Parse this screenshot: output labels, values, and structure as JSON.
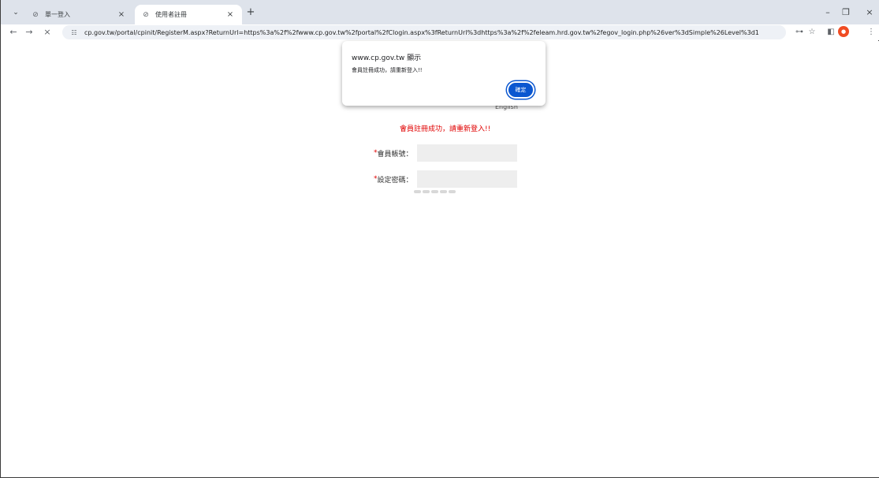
{
  "browser": {
    "tabs": [
      {
        "title": "單一登入",
        "favicon": "globe-icon",
        "active": false
      },
      {
        "title": "使用者註冊",
        "favicon": "globe-icon",
        "active": true
      }
    ],
    "url": "cp.gov.tw/portal/cpinit/RegisterM.aspx?ReturnUrl=https%3a%2f%2fwww.cp.gov.tw%2fportal%2fClogin.aspx%3fReturnUrl%3dhttps%3a%2f%2feleam.hrd.gov.tw%2fegov_login.php%26ver%3dSimple%26Level%3d1"
  },
  "page": {
    "language_link": "English",
    "success_message": "會員註冊成功，請重新登入!!",
    "form": {
      "account": {
        "required_mark": "*",
        "label": "會員帳號：",
        "value": ""
      },
      "password": {
        "required_mark": "*",
        "label": "設定密碼：",
        "value": ""
      }
    }
  },
  "dialog": {
    "origin": "www.cp.gov.tw 顯示",
    "message": "會員註冊成功，請重新登入!!",
    "ok_label": "確定"
  },
  "colors": {
    "error_text": "#e00000",
    "dialog_button": "#0b57d0",
    "tabstrip": "#dee3eb"
  }
}
